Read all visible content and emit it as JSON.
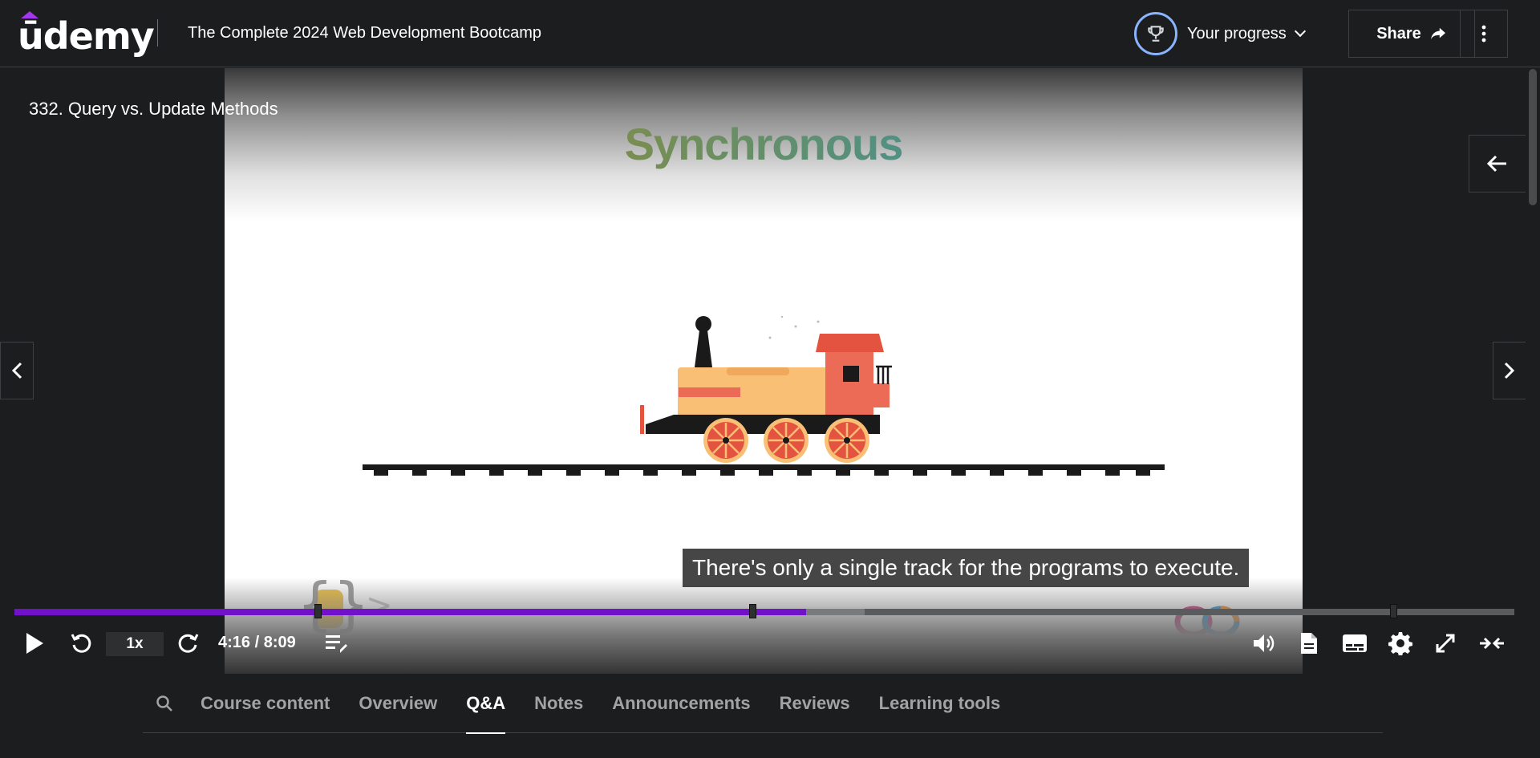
{
  "header": {
    "logo_text": "ūdemy",
    "course_title": "The Complete 2024 Web Development Bootcamp",
    "progress_label": "Your progress",
    "share_label": "Share",
    "trophy_icon": "trophy-icon",
    "more_icon": "more-vertical-icon"
  },
  "player": {
    "lecture_title": "332. Query vs. Update Methods",
    "slide_heading": "Synchronous",
    "subtitle": "There's only a single track for the programs to execute.",
    "playback_rate": "1x",
    "time_display": "4:16 / 8:09",
    "played_fraction": 0.528,
    "buffered_fraction": 0.567,
    "chapter_marks": [
      0.2,
      0.49,
      0.917
    ],
    "colors": {
      "progress": "#7111c9",
      "accent": "#a435f0"
    }
  },
  "tabs": {
    "items": [
      {
        "label": "Course content",
        "active": false
      },
      {
        "label": "Overview",
        "active": false
      },
      {
        "label": "Q&A",
        "active": true
      },
      {
        "label": "Notes",
        "active": false
      },
      {
        "label": "Announcements",
        "active": false
      },
      {
        "label": "Reviews",
        "active": false
      },
      {
        "label": "Learning tools",
        "active": false
      }
    ]
  }
}
